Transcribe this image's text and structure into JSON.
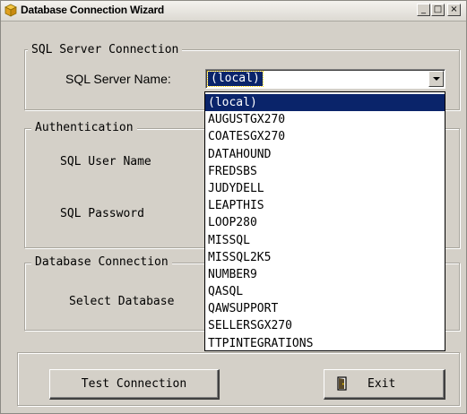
{
  "window": {
    "title": "Database Connection Wizard",
    "controls": {
      "minimize": "_",
      "maximize": "□",
      "close": "×"
    }
  },
  "sql_server_connection": {
    "legend": "SQL Server Connection",
    "server_name_label": "SQL Server Name:",
    "selected_value": "(local)",
    "options": [
      "(local)",
      "AUGUSTGX270",
      "COATESGX270",
      "DATAHOUND",
      "FREDSBS",
      "JUDYDELL",
      "LEAPTHIS",
      "LOOP280",
      "MISSQL",
      "MISSQL2K5",
      "NUMBER9",
      "QASQL",
      "QAWSUPPORT",
      "SELLERSGX270",
      "TTPINTEGRATIONS"
    ]
  },
  "authentication": {
    "legend": "Authentication",
    "user_label": "SQL User Name",
    "password_label": "SQL Password"
  },
  "database_connection": {
    "legend": "Database Connection",
    "select_label": "Select Database"
  },
  "buttons": {
    "test_connection": "Test Connection",
    "exit": "Exit"
  },
  "icons": {
    "title_icon": "database-wizard-icon",
    "exit_icon": "door-exit-icon"
  },
  "colors": {
    "selection": "#0a246a",
    "window_bg": "#d4d0c8"
  }
}
